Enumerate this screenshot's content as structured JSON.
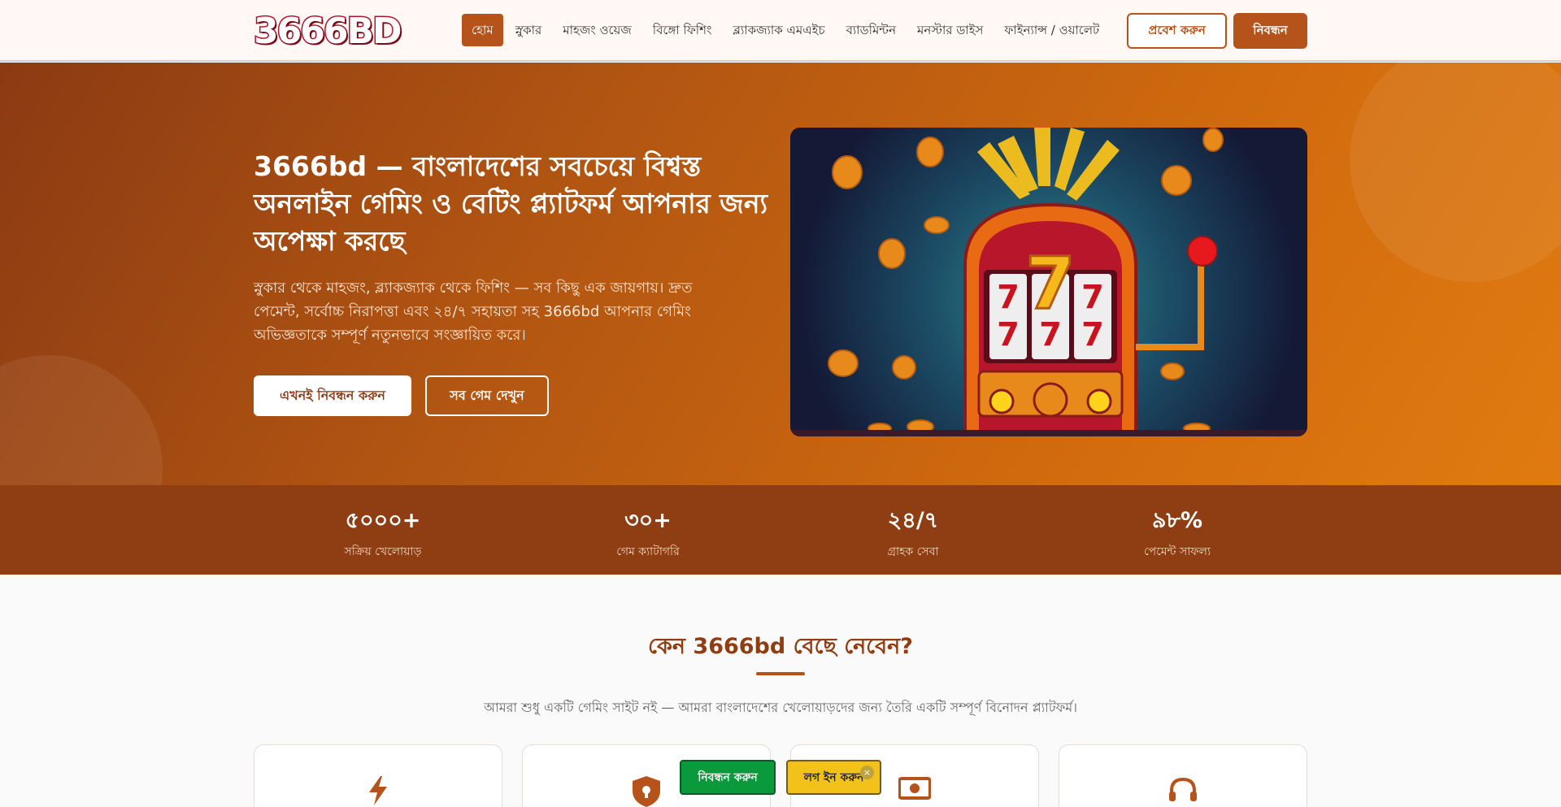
{
  "header": {
    "logo_text": "3666BD",
    "nav": [
      {
        "label": "হোম",
        "active": true
      },
      {
        "label": "স্নুকার"
      },
      {
        "label": "মাহজং ওয়েজ"
      },
      {
        "label": "বিঙ্গো ফিশিং"
      },
      {
        "label": "ব্ল্যাকজ্যাক এমএইচ"
      },
      {
        "label": "ব্যাডমিন্টন"
      },
      {
        "label": "মনস্টার ডাইস"
      },
      {
        "label": "ফাইন্যান্স / ওয়ালেট"
      }
    ],
    "login_label": "প্রবেশ করুন",
    "register_label": "নিবন্ধন"
  },
  "hero": {
    "title": "3666bd — বাংলাদেশের সবচেয়ে বিশ্বস্ত অনলাইন গেমিং ও বেটিং প্ল্যাটফর্ম আপনার জন্য অপেক্ষা করছে",
    "description": "স্নুকার থেকে মাহজং, ব্ল্যাকজ্যাক থেকে ফিশিং — সব কিছু এক জায়গায়। দ্রুত পেমেন্ট, সর্বোচ্চ নিরাপত্তা এবং ২৪/৭ সহায়তা সহ 3666bd আপনার গেমিং অভিজ্ঞতাকে সম্পূর্ণ নতুনভাবে সংজ্ঞায়িত করে।",
    "primary_button": "এখনই নিবন্ধন করুন",
    "secondary_button": "সব গেম দেখুন",
    "slot_symbol": "7"
  },
  "stats": [
    {
      "value": "৫০০০+",
      "label": "সক্রিয় খেলোয়াড়"
    },
    {
      "value": "৩০+",
      "label": "গেম ক্যাটাগরি"
    },
    {
      "value": "২৪/৭",
      "label": "গ্রাহক সেবা"
    },
    {
      "value": "৯৮%",
      "label": "পেমেন্ট সাফল্য"
    }
  ],
  "why": {
    "title": "কেন 3666bd বেছে নেবেন?",
    "subtitle": "আমরা শুধু একটি গেমিং সাইট নই — আমরা বাংলাদেশের খেলোয়াড়দের জন্য তৈরি একটি সম্পূর্ণ বিনোদন প্ল্যাটফর্ম।",
    "card_icons": [
      "lightning-icon",
      "shield-lock-icon",
      "cash-icon",
      "headset-icon"
    ]
  },
  "floating": {
    "register_label": "নিবন্ধন করুন",
    "login_label": "লগ ইন করুন",
    "close_glyph": "×"
  },
  "colors": {
    "accent": "#b5531a",
    "stats_bg": "#8e3e12",
    "float_register": "#0a9a3c",
    "float_login": "#f2c21a"
  }
}
